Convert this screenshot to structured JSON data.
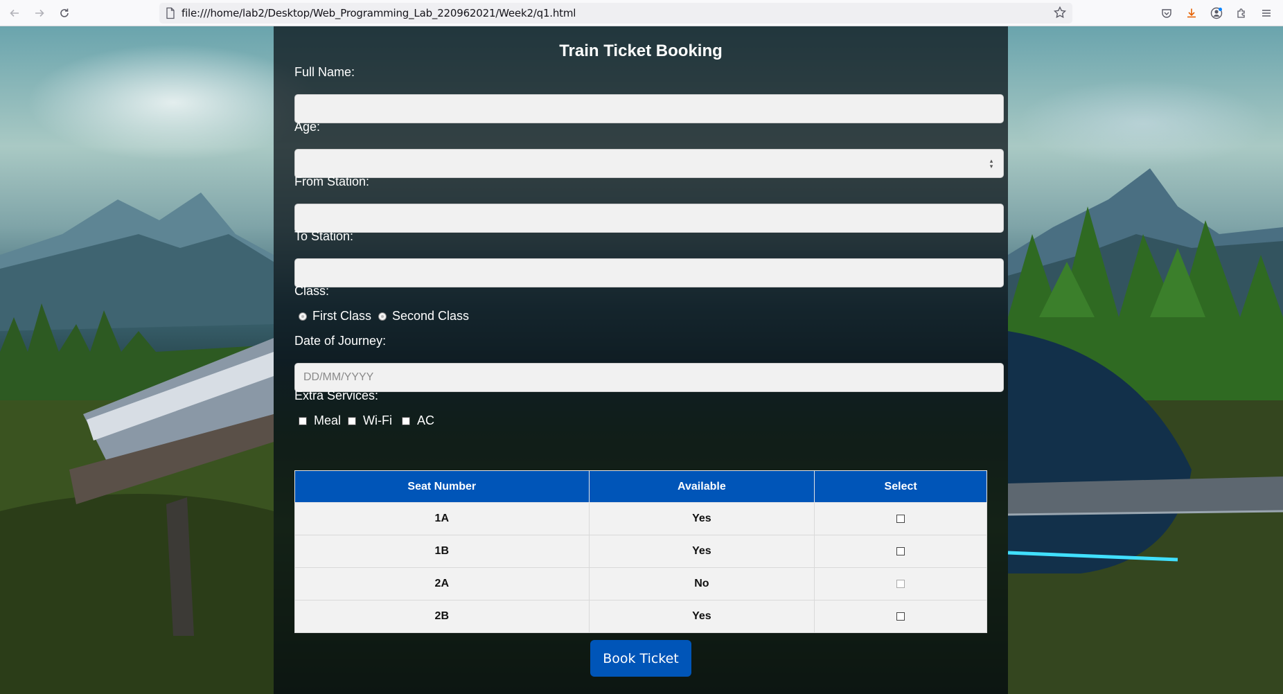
{
  "browser": {
    "url": "file:///home/lab2/Desktop/Web_Programming_Lab_220962021/Week2/q1.html"
  },
  "form": {
    "title": "Train Ticket Booking",
    "full_name_label": "Full Name:",
    "full_name_value": "",
    "age_label": "Age:",
    "age_value": "",
    "from_label": "From Station:",
    "from_value": "",
    "to_label": "To Station:",
    "to_value": "",
    "class_label": "Class:",
    "class_options": [
      "First Class",
      "Second Class"
    ],
    "date_label": "Date of Journey:",
    "date_placeholder": "DD/MM/YYYY",
    "extras_label": "Extra Services:",
    "extras_options": [
      "Meal",
      "Wi-Fi",
      "AC"
    ]
  },
  "seats": {
    "headers": [
      "Seat Number",
      "Available",
      "Select"
    ],
    "rows": [
      {
        "seat": "1A",
        "available": "Yes",
        "selectable": true
      },
      {
        "seat": "1B",
        "available": "Yes",
        "selectable": true
      },
      {
        "seat": "2A",
        "available": "No",
        "selectable": false
      },
      {
        "seat": "2B",
        "available": "Yes",
        "selectable": true
      }
    ]
  },
  "book_button_label": "Book Ticket",
  "colors": {
    "accent": "#0055b8"
  }
}
